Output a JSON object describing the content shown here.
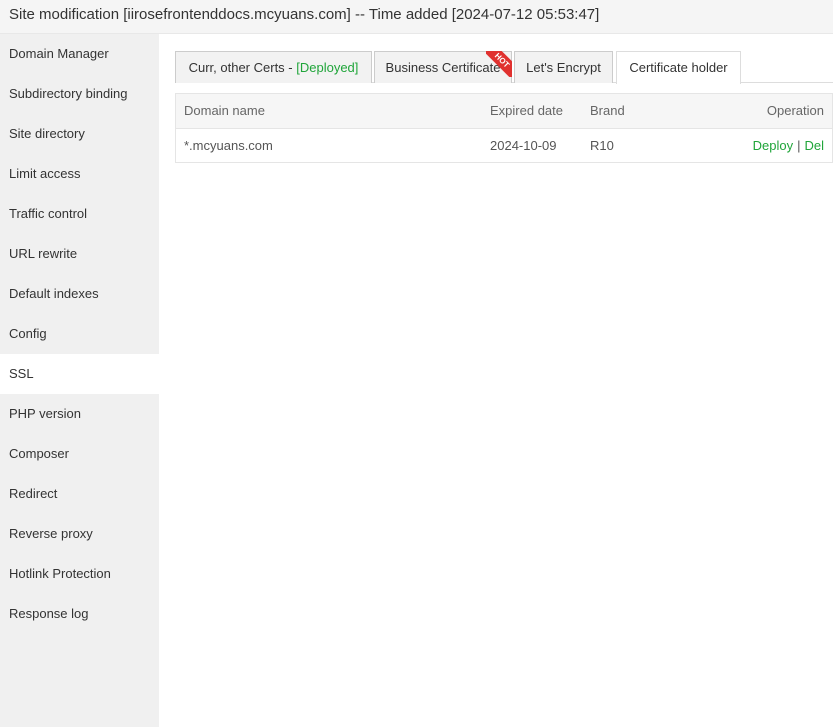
{
  "window": {
    "title": "Site modification [iirosefrontenddocs.mcyuans.com] -- Time added [2024-07-12 05:53:47]"
  },
  "sidebar": {
    "items": [
      {
        "label": "Domain Manager"
      },
      {
        "label": "Subdirectory binding"
      },
      {
        "label": "Site directory"
      },
      {
        "label": "Limit access"
      },
      {
        "label": "Traffic control"
      },
      {
        "label": "URL rewrite"
      },
      {
        "label": "Default indexes"
      },
      {
        "label": "Config"
      },
      {
        "label": "SSL",
        "active": true
      },
      {
        "label": "PHP version"
      },
      {
        "label": "Composer"
      },
      {
        "label": "Redirect"
      },
      {
        "label": "Reverse proxy"
      },
      {
        "label": "Hotlink Protection"
      },
      {
        "label": "Response log"
      }
    ]
  },
  "tabs": {
    "current": {
      "label": "Curr, other Certs - ",
      "status": "[Deployed]"
    },
    "business": {
      "label": "Business Certificate",
      "badge": "HOT"
    },
    "letsencrypt": {
      "label": "Let's Encrypt"
    },
    "holder": {
      "label": "Certificate holder"
    }
  },
  "table": {
    "headers": {
      "domain": "Domain name",
      "expired": "Expired date",
      "brand": "Brand",
      "operation": "Operation"
    },
    "rows": [
      {
        "domain": "*.mcyuans.com",
        "expired": "2024-10-09",
        "brand": "R10",
        "deploy": "Deploy",
        "sep": "|",
        "del": "Del"
      }
    ]
  },
  "colors": {
    "accent_green": "#20a53a",
    "hot_red": "#e0312f",
    "sidebar_bg": "#f0f0f0"
  }
}
